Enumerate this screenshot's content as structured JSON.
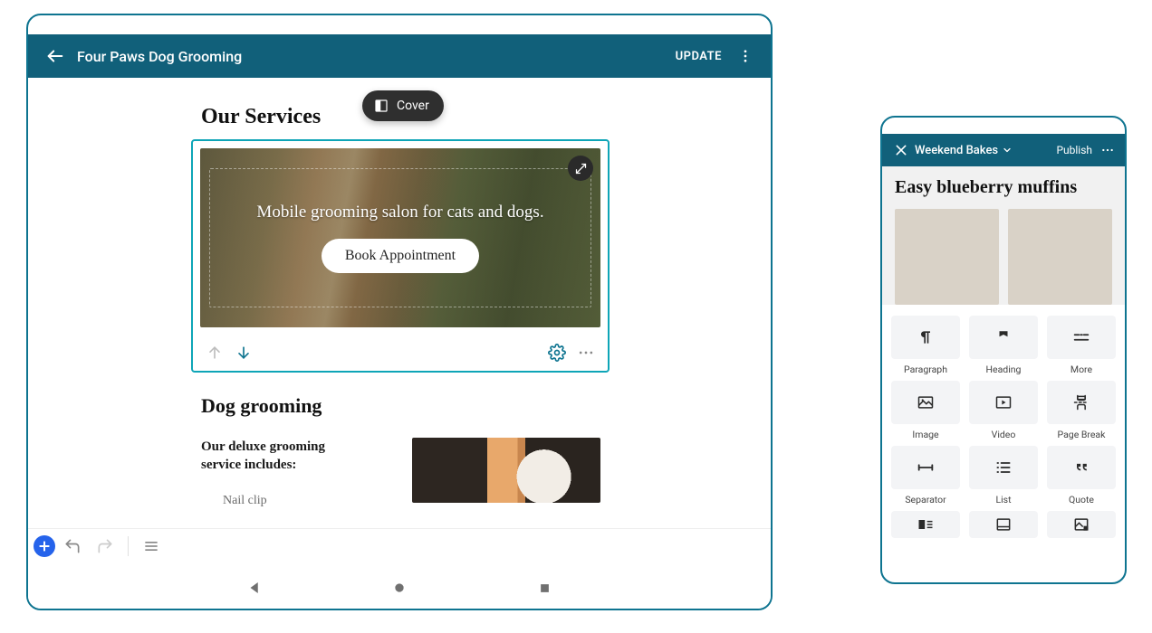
{
  "tablet": {
    "appbar": {
      "title": "Four Paws Dog Grooming",
      "update": "UPDATE"
    },
    "block_label": "Cover",
    "section_heading": "Our Services",
    "cover": {
      "text": "Mobile grooming salon for cats and dogs.",
      "button": "Book Appointment"
    },
    "sub_heading": "Dog grooming",
    "sub_para": "Our deluxe grooming service includes:",
    "list_item": "Nail clip"
  },
  "phone": {
    "appbar": {
      "title": "Weekend Bakes",
      "publish": "Publish"
    },
    "post_title": "Easy blueberry muffins",
    "inserter": {
      "paragraph": "Paragraph",
      "heading": "Heading",
      "more": "More",
      "image": "Image",
      "video": "Video",
      "page_break": "Page Break",
      "separator": "Separator",
      "list": "List",
      "quote": "Quote"
    }
  }
}
